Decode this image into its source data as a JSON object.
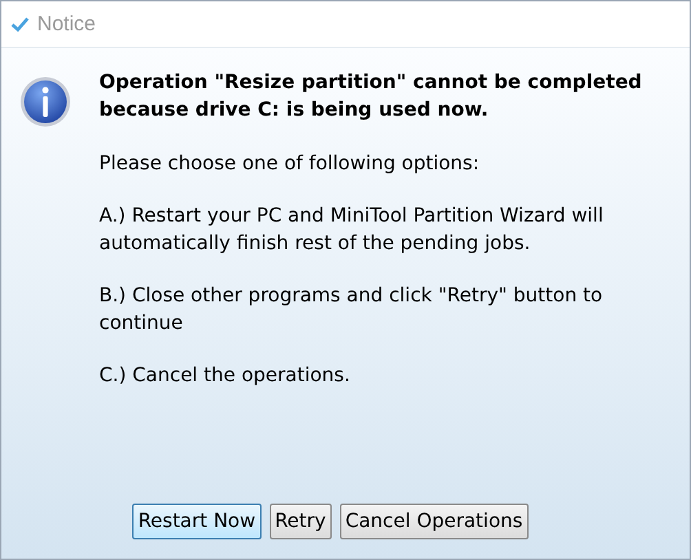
{
  "window": {
    "title": "Notice"
  },
  "message": {
    "heading": "Operation \"Resize partition\" cannot be completed because drive C: is being used now.",
    "paragraphs": [
      "Please choose one of following options:",
      "A.) Restart your PC and MiniTool Partition Wizard will automatically finish rest of the pending jobs.",
      "B.) Close other programs and click \"Retry\" button to continue",
      "C.) Cancel the operations."
    ]
  },
  "buttons": [
    {
      "label": "Restart Now",
      "focused": true
    },
    {
      "label": "Retry",
      "focused": false
    },
    {
      "label": "Cancel Operations",
      "focused": false
    }
  ]
}
